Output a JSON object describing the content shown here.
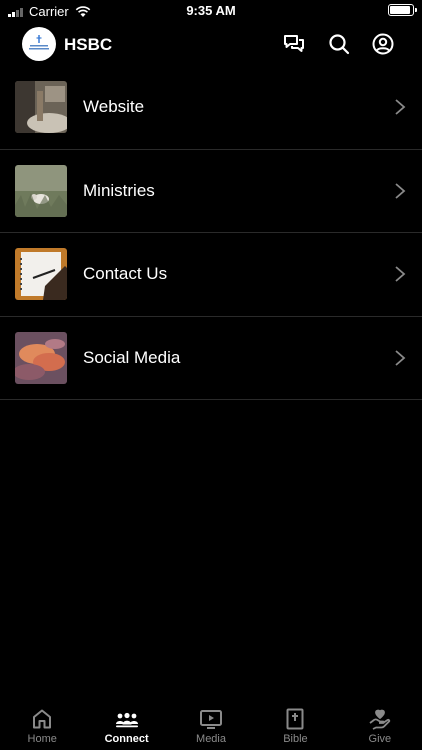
{
  "status_bar": {
    "carrier": "Carrier",
    "time": "9:35 AM"
  },
  "header": {
    "title": "HSBC",
    "logo_text": "Hunt Springs Baptist Church"
  },
  "list": {
    "items": [
      {
        "label": "Website",
        "icon": "living-room-photo"
      },
      {
        "label": "Ministries",
        "icon": "sheep-field-photo"
      },
      {
        "label": "Contact Us",
        "icon": "notebook-pen-photo"
      },
      {
        "label": "Social Media",
        "icon": "sunset-clouds-photo"
      }
    ]
  },
  "tabs": [
    {
      "label": "Home",
      "icon": "home-icon",
      "active": false
    },
    {
      "label": "Connect",
      "icon": "people-icon",
      "active": true
    },
    {
      "label": "Media",
      "icon": "play-screen-icon",
      "active": false
    },
    {
      "label": "Bible",
      "icon": "bible-icon",
      "active": false
    },
    {
      "label": "Give",
      "icon": "give-heart-icon",
      "active": false
    }
  ],
  "colors": {
    "background": "#000000",
    "active_tab": "#ffffff",
    "inactive_tab": "#8a8a8a",
    "divider": "#2a2a2a"
  }
}
